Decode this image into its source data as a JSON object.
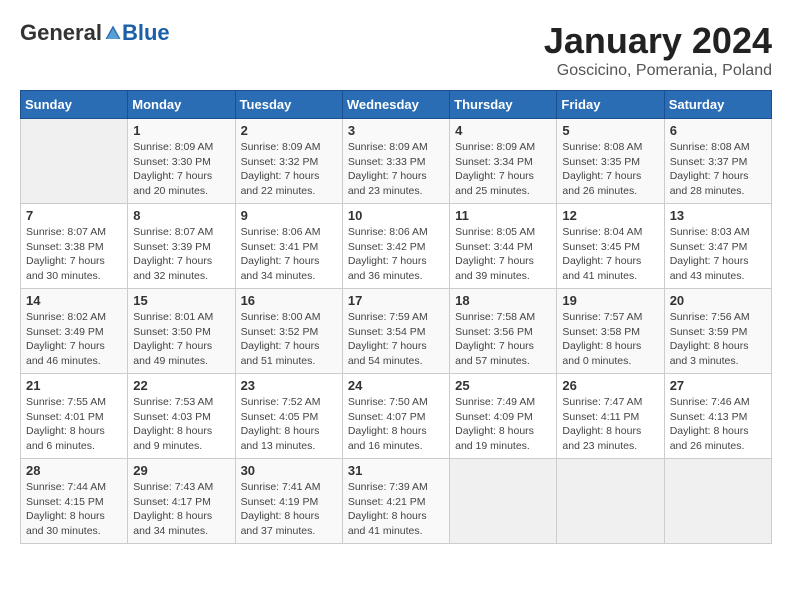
{
  "header": {
    "logo_general": "General",
    "logo_blue": "Blue",
    "title": "January 2024",
    "location": "Goscicino, Pomerania, Poland"
  },
  "days_of_week": [
    "Sunday",
    "Monday",
    "Tuesday",
    "Wednesday",
    "Thursday",
    "Friday",
    "Saturday"
  ],
  "weeks": [
    [
      {
        "day": "",
        "info": ""
      },
      {
        "day": "1",
        "info": "Sunrise: 8:09 AM\nSunset: 3:30 PM\nDaylight: 7 hours\nand 20 minutes."
      },
      {
        "day": "2",
        "info": "Sunrise: 8:09 AM\nSunset: 3:32 PM\nDaylight: 7 hours\nand 22 minutes."
      },
      {
        "day": "3",
        "info": "Sunrise: 8:09 AM\nSunset: 3:33 PM\nDaylight: 7 hours\nand 23 minutes."
      },
      {
        "day": "4",
        "info": "Sunrise: 8:09 AM\nSunset: 3:34 PM\nDaylight: 7 hours\nand 25 minutes."
      },
      {
        "day": "5",
        "info": "Sunrise: 8:08 AM\nSunset: 3:35 PM\nDaylight: 7 hours\nand 26 minutes."
      },
      {
        "day": "6",
        "info": "Sunrise: 8:08 AM\nSunset: 3:37 PM\nDaylight: 7 hours\nand 28 minutes."
      }
    ],
    [
      {
        "day": "7",
        "info": "Sunrise: 8:07 AM\nSunset: 3:38 PM\nDaylight: 7 hours\nand 30 minutes."
      },
      {
        "day": "8",
        "info": "Sunrise: 8:07 AM\nSunset: 3:39 PM\nDaylight: 7 hours\nand 32 minutes."
      },
      {
        "day": "9",
        "info": "Sunrise: 8:06 AM\nSunset: 3:41 PM\nDaylight: 7 hours\nand 34 minutes."
      },
      {
        "day": "10",
        "info": "Sunrise: 8:06 AM\nSunset: 3:42 PM\nDaylight: 7 hours\nand 36 minutes."
      },
      {
        "day": "11",
        "info": "Sunrise: 8:05 AM\nSunset: 3:44 PM\nDaylight: 7 hours\nand 39 minutes."
      },
      {
        "day": "12",
        "info": "Sunrise: 8:04 AM\nSunset: 3:45 PM\nDaylight: 7 hours\nand 41 minutes."
      },
      {
        "day": "13",
        "info": "Sunrise: 8:03 AM\nSunset: 3:47 PM\nDaylight: 7 hours\nand 43 minutes."
      }
    ],
    [
      {
        "day": "14",
        "info": "Sunrise: 8:02 AM\nSunset: 3:49 PM\nDaylight: 7 hours\nand 46 minutes."
      },
      {
        "day": "15",
        "info": "Sunrise: 8:01 AM\nSunset: 3:50 PM\nDaylight: 7 hours\nand 49 minutes."
      },
      {
        "day": "16",
        "info": "Sunrise: 8:00 AM\nSunset: 3:52 PM\nDaylight: 7 hours\nand 51 minutes."
      },
      {
        "day": "17",
        "info": "Sunrise: 7:59 AM\nSunset: 3:54 PM\nDaylight: 7 hours\nand 54 minutes."
      },
      {
        "day": "18",
        "info": "Sunrise: 7:58 AM\nSunset: 3:56 PM\nDaylight: 7 hours\nand 57 minutes."
      },
      {
        "day": "19",
        "info": "Sunrise: 7:57 AM\nSunset: 3:58 PM\nDaylight: 8 hours\nand 0 minutes."
      },
      {
        "day": "20",
        "info": "Sunrise: 7:56 AM\nSunset: 3:59 PM\nDaylight: 8 hours\nand 3 minutes."
      }
    ],
    [
      {
        "day": "21",
        "info": "Sunrise: 7:55 AM\nSunset: 4:01 PM\nDaylight: 8 hours\nand 6 minutes."
      },
      {
        "day": "22",
        "info": "Sunrise: 7:53 AM\nSunset: 4:03 PM\nDaylight: 8 hours\nand 9 minutes."
      },
      {
        "day": "23",
        "info": "Sunrise: 7:52 AM\nSunset: 4:05 PM\nDaylight: 8 hours\nand 13 minutes."
      },
      {
        "day": "24",
        "info": "Sunrise: 7:50 AM\nSunset: 4:07 PM\nDaylight: 8 hours\nand 16 minutes."
      },
      {
        "day": "25",
        "info": "Sunrise: 7:49 AM\nSunset: 4:09 PM\nDaylight: 8 hours\nand 19 minutes."
      },
      {
        "day": "26",
        "info": "Sunrise: 7:47 AM\nSunset: 4:11 PM\nDaylight: 8 hours\nand 23 minutes."
      },
      {
        "day": "27",
        "info": "Sunrise: 7:46 AM\nSunset: 4:13 PM\nDaylight: 8 hours\nand 26 minutes."
      }
    ],
    [
      {
        "day": "28",
        "info": "Sunrise: 7:44 AM\nSunset: 4:15 PM\nDaylight: 8 hours\nand 30 minutes."
      },
      {
        "day": "29",
        "info": "Sunrise: 7:43 AM\nSunset: 4:17 PM\nDaylight: 8 hours\nand 34 minutes."
      },
      {
        "day": "30",
        "info": "Sunrise: 7:41 AM\nSunset: 4:19 PM\nDaylight: 8 hours\nand 37 minutes."
      },
      {
        "day": "31",
        "info": "Sunrise: 7:39 AM\nSunset: 4:21 PM\nDaylight: 8 hours\nand 41 minutes."
      },
      {
        "day": "",
        "info": ""
      },
      {
        "day": "",
        "info": ""
      },
      {
        "day": "",
        "info": ""
      }
    ]
  ]
}
